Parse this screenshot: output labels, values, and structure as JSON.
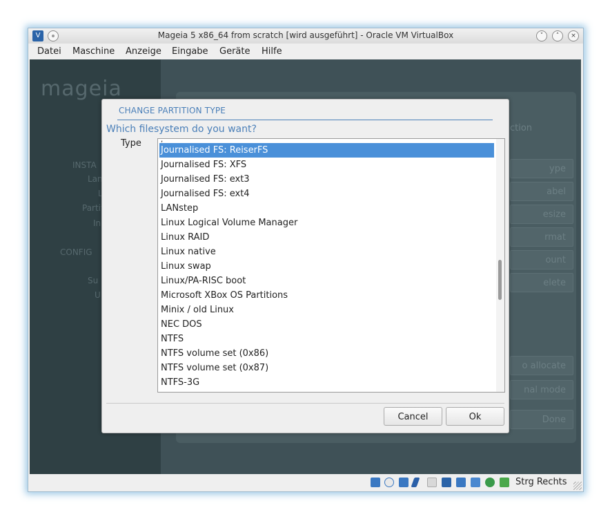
{
  "window": {
    "title": "Mageia 5 x86_64 from scratch [wird ausgeführt] - Oracle VM VirtualBox",
    "app_icon": "virtualbox-icon",
    "controls": [
      "minimize-icon",
      "maximize-icon",
      "close-icon"
    ]
  },
  "menubar": {
    "items": [
      "Datei",
      "Maschine",
      "Anzeige",
      "Eingabe",
      "Geräte",
      "Hilfe"
    ]
  },
  "vm_background": {
    "logo": "mageia",
    "sidebar": [
      "INSTA",
      "Lan",
      "L",
      "Partit",
      "In",
      "CONFIG",
      "Su",
      "U"
    ],
    "buttons": [
      "ype",
      "abel",
      "esize",
      "rmat",
      "ount",
      "elete",
      "o allocate",
      "nal mode",
      "Done"
    ],
    "fragment": "ction"
  },
  "dialog": {
    "title": "CHANGE PARTITION TYPE",
    "question": "Which filesystem do you want?",
    "type_label": "Type",
    "items": [
      "Journalised FS: ReiserFS",
      "Journalised FS: XFS",
      "Journalised FS: ext3",
      "Journalised FS: ext4",
      "LANstep",
      "Linux Logical Volume Manager",
      "Linux RAID",
      "Linux native",
      "Linux swap",
      "Linux/PA-RISC boot",
      "Microsoft XBox OS Partitions",
      "Minix / old Linux",
      "NEC DOS",
      "NTFS",
      "NTFS volume set (0x86)",
      "NTFS volume set (0x87)",
      "NTFS-3G"
    ],
    "selected_index": 0,
    "cancel_label": "Cancel",
    "ok_label": "Ok"
  },
  "statusbar": {
    "host_key": "Strg Rechts",
    "icons": [
      "hdd-icon",
      "cd-icon",
      "network-icon",
      "usb-icon",
      "shared-folder-icon",
      "display-icon",
      "capture-icon",
      "cpu-icon",
      "mouse-integration-icon",
      "arrow-down-icon"
    ]
  },
  "colors": {
    "accent": "#4a7fb8",
    "selection": "#4a90d9"
  }
}
